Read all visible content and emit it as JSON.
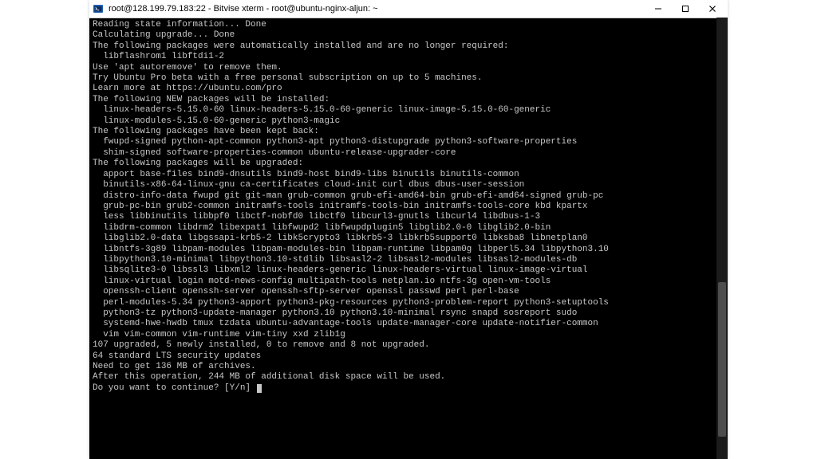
{
  "window": {
    "title": "root@128.199.79.183:22 - Bitvise xterm - root@ubuntu-nginx-aljun: ~"
  },
  "terminal": {
    "lines": [
      "Reading state information... Done",
      "Calculating upgrade... Done",
      "The following packages were automatically installed and are no longer required:",
      "  libflashrom1 libftdi1-2",
      "Use 'apt autoremove' to remove them.",
      "Try Ubuntu Pro beta with a free personal subscription on up to 5 machines.",
      "Learn more at https://ubuntu.com/pro",
      "The following NEW packages will be installed:",
      "  linux-headers-5.15.0-60 linux-headers-5.15.0-60-generic linux-image-5.15.0-60-generic",
      "  linux-modules-5.15.0-60-generic python3-magic",
      "The following packages have been kept back:",
      "  fwupd-signed python-apt-common python3-apt python3-distupgrade python3-software-properties",
      "  shim-signed software-properties-common ubuntu-release-upgrader-core",
      "The following packages will be upgraded:",
      "  apport base-files bind9-dnsutils bind9-host bind9-libs binutils binutils-common",
      "  binutils-x86-64-linux-gnu ca-certificates cloud-init curl dbus dbus-user-session",
      "  distro-info-data fwupd git git-man grub-common grub-efi-amd64-bin grub-efi-amd64-signed grub-pc",
      "  grub-pc-bin grub2-common initramfs-tools initramfs-tools-bin initramfs-tools-core kbd kpartx",
      "  less libbinutils libbpf0 libctf-nobfd0 libctf0 libcurl3-gnutls libcurl4 libdbus-1-3",
      "  libdrm-common libdrm2 libexpat1 libfwupd2 libfwupdplugin5 libglib2.0-0 libglib2.0-bin",
      "  libglib2.0-data libgssapi-krb5-2 libk5crypto3 libkrb5-3 libkrb5support0 libksba8 libnetplan0",
      "  libntfs-3g89 libpam-modules libpam-modules-bin libpam-runtime libpam0g libperl5.34 libpython3.10",
      "  libpython3.10-minimal libpython3.10-stdlib libsasl2-2 libsasl2-modules libsasl2-modules-db",
      "  libsqlite3-0 libssl3 libxml2 linux-headers-generic linux-headers-virtual linux-image-virtual",
      "  linux-virtual login motd-news-config multipath-tools netplan.io ntfs-3g open-vm-tools",
      "  openssh-client openssh-server openssh-sftp-server openssl passwd perl perl-base",
      "  perl-modules-5.34 python3-apport python3-pkg-resources python3-problem-report python3-setuptools",
      "  python3-tz python3-update-manager python3.10 python3.10-minimal rsync snapd sosreport sudo",
      "  systemd-hwe-hwdb tmux tzdata ubuntu-advantage-tools update-manager-core update-notifier-common",
      "  vim vim-common vim-runtime vim-tiny xxd zlib1g",
      "107 upgraded, 5 newly installed, 0 to remove and 8 not upgraded.",
      "64 standard LTS security updates",
      "Need to get 136 MB of archives.",
      "After this operation, 244 MB of additional disk space will be used.",
      "Do you want to continue? [Y/n] "
    ]
  }
}
